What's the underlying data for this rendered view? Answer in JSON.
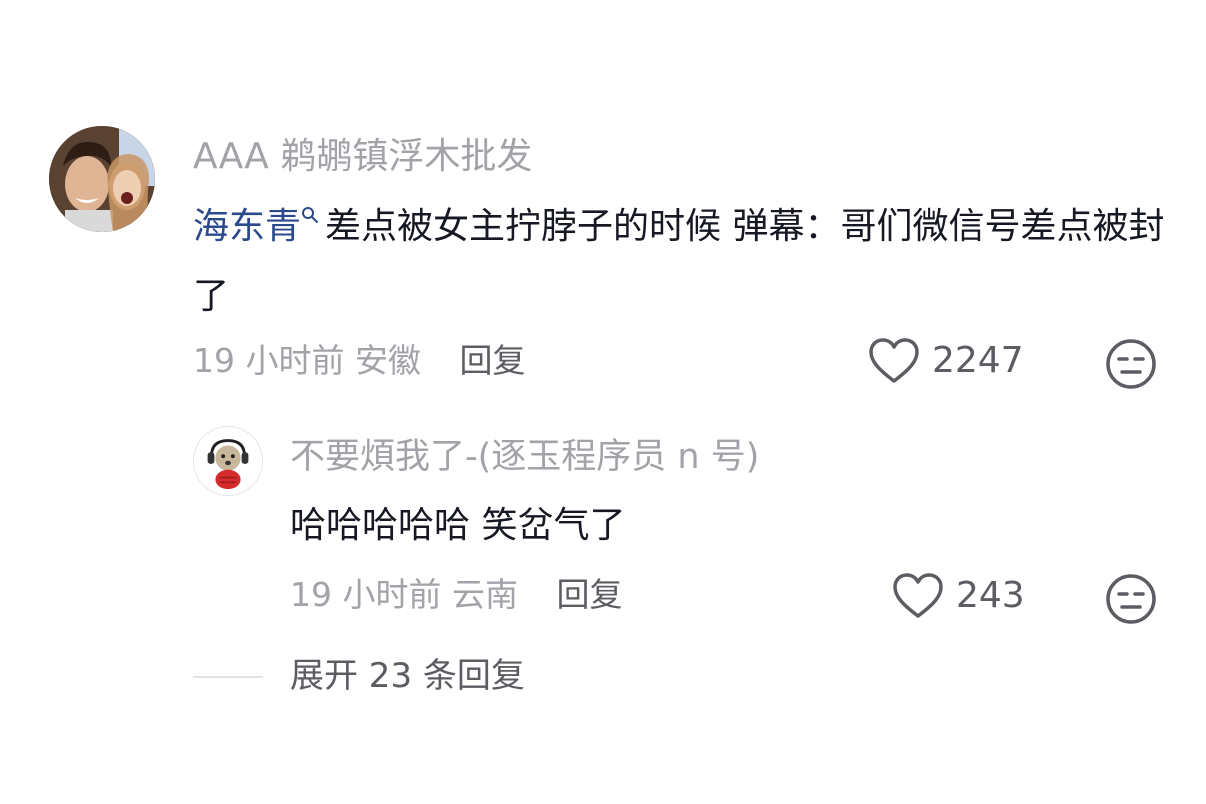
{
  "comment": {
    "username": "AAA 鹈鹕镇浮木批发",
    "mention": "海东青",
    "text": "差点被女主拧脖子的时候 弹幕：哥们微信号差点被封了",
    "time": "19 小时前",
    "location": "安徽",
    "reply_label": "回复",
    "like_count": "2247"
  },
  "reply": {
    "username": "不要煩我了-(逐玉程序员 n 号)",
    "text": "哈哈哈哈哈  笑岔气了",
    "time": "19 小时前",
    "location": "云南",
    "reply_label": "回复",
    "like_count": "243"
  },
  "expand_label": "展开 23 条回复",
  "colors": {
    "mention": "#2b4a8c",
    "meta_gray": "#a2a3a8",
    "action_gray": "#5c5d63",
    "text": "#161823"
  }
}
